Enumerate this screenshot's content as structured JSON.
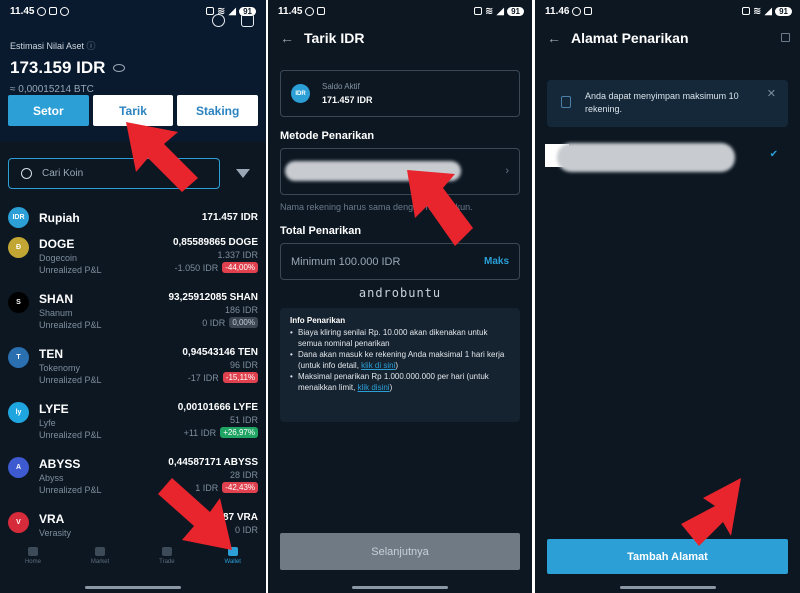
{
  "colors": {
    "accent": "#2b9fd6",
    "background": "#0c1722",
    "arrow": "#e8242c",
    "negative": "#e0414f",
    "positive": "#1fa463"
  },
  "screen1": {
    "status": {
      "time": "11.45",
      "battery": "91"
    },
    "estimate_label": "Estimasi Nilai Aset",
    "estimate_value": "173.159 IDR",
    "estimate_btc": "≈ 0,00015214 BTC",
    "buttons": {
      "setor": "Setor",
      "tarik": "Tarik",
      "staking": "Staking"
    },
    "search": {
      "placeholder": "Cari Koin"
    },
    "assets": [
      {
        "icon": "IDR",
        "name": "Rupiah",
        "full": "",
        "pnl_label": "",
        "amount": "171.457 IDR",
        "idr": "",
        "pnl": "",
        "pct": "",
        "trend": ""
      },
      {
        "icon": "Ð",
        "name": "DOGE",
        "full": "Dogecoin",
        "pnl_label": "Unrealized P&L",
        "amount": "0,85589865 DOGE",
        "idr": "1.337 IDR",
        "pnl": "-1.050 IDR",
        "pct": "-44,00%",
        "trend": "red"
      },
      {
        "icon": "S",
        "name": "SHAN",
        "full": "Shanum",
        "pnl_label": "Unrealized P&L",
        "amount": "93,25912085 SHAN",
        "idr": "186 IDR",
        "pnl": "0 IDR",
        "pct": "0,00%",
        "trend": "gray"
      },
      {
        "icon": "T",
        "name": "TEN",
        "full": "Tokenomy",
        "pnl_label": "Unrealized P&L",
        "amount": "0,94543146 TEN",
        "idr": "96 IDR",
        "pnl": "-17 IDR",
        "pct": "-15,11%",
        "trend": "red"
      },
      {
        "icon": "ly",
        "name": "LYFE",
        "full": "Lyfe",
        "pnl_label": "Unrealized P&L",
        "amount": "0,00101666 LYFE",
        "idr": "51 IDR",
        "pnl": "+11 IDR",
        "pct": "+26,97%",
        "trend": "green"
      },
      {
        "icon": "A",
        "name": "ABYSS",
        "full": "Abyss",
        "pnl_label": "Unrealized P&L",
        "amount": "0,44587171 ABYSS",
        "idr": "28 IDR",
        "pnl": "1 IDR",
        "pct": "-42,43%",
        "trend": "red"
      },
      {
        "icon": "V",
        "name": "VRA",
        "full": "Verasity",
        "pnl_label": "",
        "amount": "387 VRA",
        "idr": "0 IDR",
        "pnl": "",
        "pct": "",
        "trend": ""
      }
    ],
    "nav": [
      "Home",
      "Market",
      "Trade",
      "Wallet"
    ]
  },
  "screen2": {
    "status": {
      "time": "11.45",
      "battery": "91"
    },
    "title": "Tarik IDR",
    "saldo_label": "Saldo Aktif",
    "saldo_value": "171.457 IDR",
    "saldo_icon": "IDR",
    "method_label": "Metode Penarikan",
    "hint": "Nama rekening harus sama dengan nama akun.",
    "total_label": "Total Penarikan",
    "amount_placeholder": "Minimum 100.000 IDR",
    "max_label": "Maks",
    "watermark": "androbuntu",
    "info": {
      "title": "Info Penarikan",
      "item1": "Biaya kliring senilai Rp. 10.000 akan dikenakan untuk semua nominal penarikan",
      "item2_text": "Dana akan masuk ke rekening Anda maksimal 1 hari kerja (untuk info detail, ",
      "item2_link": "klik di sini",
      "item2_end": ")",
      "item3_text": "Maksimal penarikan Rp 1.000.000.000 per hari (untuk menaikkan limit, ",
      "item3_link": "klik disini",
      "item3_end": ")"
    },
    "next_button": "Selanjutnya"
  },
  "screen3": {
    "status": {
      "time": "11.46",
      "battery": "91"
    },
    "title": "Alamat Penarikan",
    "notice": "Anda dapat menyimpan maksimum 10 rekening.",
    "add_button": "Tambah Alamat"
  }
}
